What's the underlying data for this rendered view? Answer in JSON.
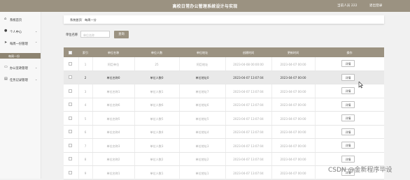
{
  "header": {
    "title": "高校日常办公管理系统设计与实现",
    "user": "当前人员 222",
    "logout": "退出登录"
  },
  "sidebar": {
    "items": [
      {
        "label": "系统首页",
        "icon": "home-icon"
      },
      {
        "label": "个人中心",
        "icon": "user-icon"
      },
      {
        "label": "每周一份管理",
        "icon": "send-icon"
      },
      {
        "label": "办公室政管理",
        "icon": "monitor-icon"
      },
      {
        "label": "任务记录管理",
        "icon": "document-icon"
      }
    ],
    "sub_item": "每周一份"
  },
  "breadcrumb": {
    "home": "系统首页",
    "separator": "/",
    "current": "每周一分"
  },
  "search": {
    "label": "单位名称",
    "placeholder": "单位名称",
    "button": "查询"
  },
  "table": {
    "headers": [
      "索引",
      "单位名称",
      "单位人数",
      "单位地址",
      "创建时间",
      "更新时间",
      "操作"
    ],
    "action_label": "详情",
    "rows": [
      {
        "index": "1",
        "name": "阿臣单位",
        "count": "25",
        "address": "阿臣地址",
        "created": "2023-04-08 00:00:00",
        "updated": "2023-04-07 00:00"
      },
      {
        "index": "2",
        "name": "单位名称0",
        "count": "单位人数0",
        "address": "单位地址0",
        "created": "2023-04-07 13:07:04",
        "updated": "2023-04-07 00:00"
      },
      {
        "index": "3",
        "name": "单位名称1",
        "count": "单位人数1",
        "address": "单位地址7",
        "created": "2023-04-07 13:07:04",
        "updated": "2023-04-07 00:00"
      },
      {
        "index": "4",
        "name": "单位名称6",
        "count": "单位人数6",
        "address": "单位地址6",
        "created": "2023-04-07 13:07:04",
        "updated": "2023-04-07 00:00"
      },
      {
        "index": "5",
        "name": "单位名称5",
        "count": "单位人数5",
        "address": "单位地址5",
        "created": "2023-04-07 13:07:04",
        "updated": "2023-04-07 00:00"
      },
      {
        "index": "6",
        "name": "单位名称4",
        "count": "单位人数4",
        "address": "单位地址4",
        "created": "2023-04-07 13:07:04",
        "updated": "2023-04-07 00:00"
      },
      {
        "index": "7",
        "name": "单位名称3",
        "count": "单位人数3",
        "address": "单位地址3",
        "created": "2023-04-07 13:07:04",
        "updated": "2023-04-07 00:00"
      },
      {
        "index": "8",
        "name": "单位名称2",
        "count": "单位人数2",
        "address": "单位地址2",
        "created": "2023-04-07 13:07:04",
        "updated": "2023-04-07 00:00"
      },
      {
        "index": "9",
        "name": "单位名称1",
        "count": "单位人数1",
        "address": "单位地址1",
        "created": "2023-04-07 13:07:04",
        "updated": "2023-04-07 00:00"
      }
    ]
  },
  "watermark": "CSDN @金新程序毕设",
  "colors": {
    "accent": "#9b9281",
    "sidebar_active": "#8d8471",
    "highlight_row": "#e9e9e9"
  }
}
